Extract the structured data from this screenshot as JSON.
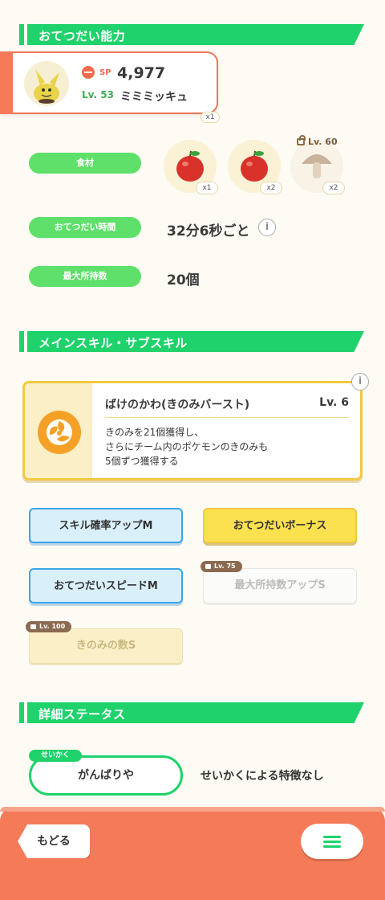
{
  "sections": {
    "helping": "おてつだい能力",
    "skills": "メインスキル・サブスキル",
    "details": "詳細ステータス"
  },
  "pokemon": {
    "sp_label": "SP",
    "sp_value": "4,977",
    "level": "Lv. 53",
    "name": "ミミミッキュ",
    "peek_badge": "x1"
  },
  "stats": {
    "ingredients_label": "食材",
    "ingredients": [
      {
        "name": "apple",
        "qty": "x1"
      },
      {
        "name": "apple",
        "qty": "x2"
      },
      {
        "name": "mushroom",
        "qty": "x2",
        "lock_level": "Lv. 60"
      }
    ],
    "help_time_label": "おてつだい時間",
    "help_time_value": "32分6秒ごと",
    "max_carry_label": "最大所持数",
    "max_carry_value": "20個"
  },
  "main_skill": {
    "title": "ばけのかわ(きのみバースト)",
    "level": "Lv. 6",
    "desc_line1": "きのみを21個獲得し、",
    "desc_line2": "さらにチーム内のポケモンのきのみも",
    "desc_line3": "5個ずつ獲得する"
  },
  "sub_skills": [
    {
      "label": "スキル確率アップM",
      "style": "blue"
    },
    {
      "label": "おてつだいボーナス",
      "style": "gold"
    },
    {
      "label": "おてつだいスピードM",
      "style": "blue"
    },
    {
      "label": "最大所持数アップS",
      "style": "locked",
      "lock_level": "Lv. 75"
    },
    {
      "label": "きのみの数S",
      "style": "locked-gold",
      "lock_level": "Lv. 100"
    }
  ],
  "nature": {
    "tag": "せいかく",
    "value": "がんばりや",
    "effect": "せいかくによる特徴なし"
  },
  "footer": {
    "back_label": "もどる"
  },
  "colors": {
    "accent_green": "#1fd26b",
    "accent_orange": "#f47a58",
    "gold": "#f2c941"
  }
}
